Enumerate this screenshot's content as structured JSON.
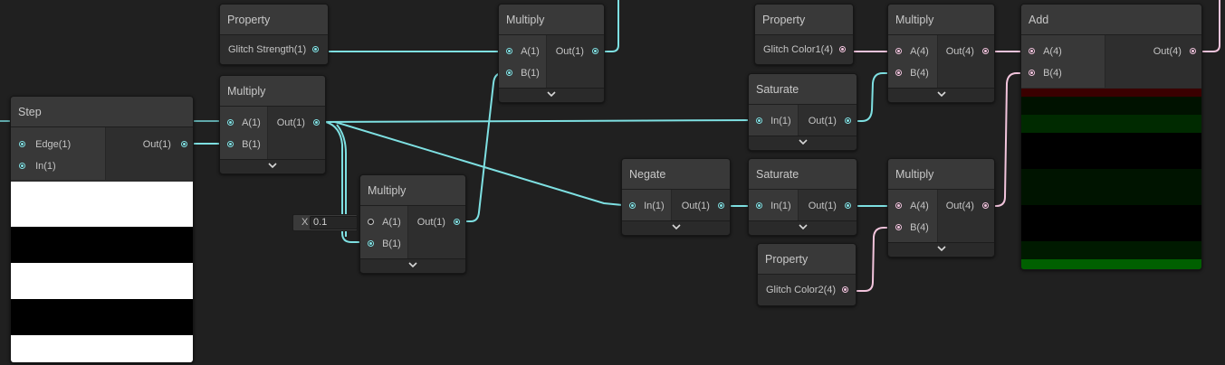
{
  "colors": {
    "float_wire": "#7ee0e2",
    "vector4_wire": "#f2c4dc",
    "node_bg": "#2c2c2c",
    "canvas_bg": "#202020"
  },
  "nodes": {
    "step": {
      "title": "Step",
      "inputs": [
        "Edge(1)",
        "In(1)"
      ],
      "outputs": [
        "Out(1)"
      ]
    },
    "property_strength": {
      "title": "Property",
      "outputs": [
        "Glitch Strength(1)"
      ]
    },
    "multiply_1": {
      "title": "Multiply",
      "inputs": [
        "A(1)",
        "B(1)"
      ],
      "outputs": [
        "Out(1)"
      ]
    },
    "multiply_2": {
      "title": "Multiply",
      "inputs": [
        "A(1)",
        "B(1)"
      ],
      "outputs": [
        "Out(1)"
      ]
    },
    "multiply_3": {
      "title": "Multiply",
      "inputs": [
        "A(1)",
        "B(1)"
      ],
      "outputs": [
        "Out(1)"
      ],
      "inline_value": {
        "label": "X",
        "value": "0.1"
      }
    },
    "negate": {
      "title": "Negate",
      "inputs": [
        "In(1)"
      ],
      "outputs": [
        "Out(1)"
      ]
    },
    "property_color1": {
      "title": "Property",
      "outputs": [
        "Glitch Color1(4)"
      ]
    },
    "saturate_1": {
      "title": "Saturate",
      "inputs": [
        "In(1)"
      ],
      "outputs": [
        "Out(1)"
      ]
    },
    "saturate_2": {
      "title": "Saturate",
      "inputs": [
        "In(1)"
      ],
      "outputs": [
        "Out(1)"
      ]
    },
    "property_color2": {
      "title": "Property",
      "outputs": [
        "Glitch Color2(4)"
      ]
    },
    "multiply_4": {
      "title": "Multiply",
      "inputs": [
        "A(4)",
        "B(4)"
      ],
      "outputs": [
        "Out(4)"
      ]
    },
    "multiply_5": {
      "title": "Multiply",
      "inputs": [
        "A(4)",
        "B(4)"
      ],
      "outputs": [
        "Out(4)"
      ]
    },
    "add": {
      "title": "Add",
      "inputs": [
        "A(4)",
        "B(4)"
      ],
      "outputs": [
        "Out(4)"
      ]
    }
  },
  "icons": {
    "collapse": "chevron-down-icon",
    "port": "port-dot-icon"
  }
}
